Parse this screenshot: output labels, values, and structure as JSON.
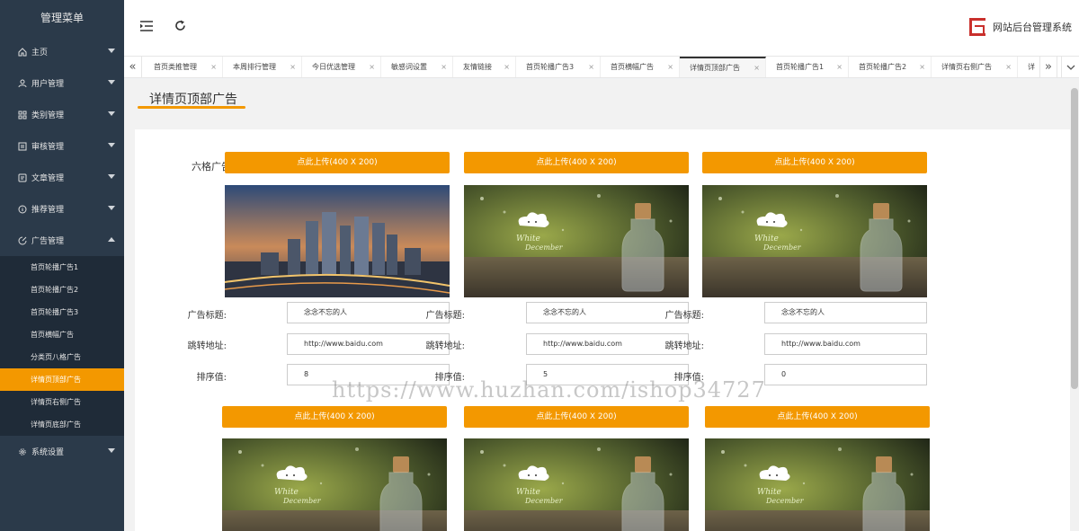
{
  "sidebar": {
    "title": "管理菜单",
    "menus": [
      {
        "label": "主页",
        "icon": "home-icon"
      },
      {
        "label": "用户管理",
        "icon": "user-icon"
      },
      {
        "label": "类别管理",
        "icon": "grid-icon"
      },
      {
        "label": "审核管理",
        "icon": "checklist-icon"
      },
      {
        "label": "文章管理",
        "icon": "article-icon"
      },
      {
        "label": "推荐管理",
        "icon": "info-icon"
      },
      {
        "label": "广告管理",
        "icon": "ad-icon"
      }
    ],
    "submenu": [
      "首页轮播广告1",
      "首页轮播广告2",
      "首页轮播广告3",
      "首页横幅广告",
      "分类页八格广告",
      "详情页顶部广告",
      "详情页右侧广告",
      "详情页底部广告"
    ],
    "active_sub_index": 5,
    "settings": {
      "label": "系统设置",
      "icon": "gear-icon"
    }
  },
  "header": {
    "collapse_icon": "menu-collapse-icon",
    "refresh_icon": "refresh-icon",
    "brand_text": "网站后台管理系统"
  },
  "tabs": {
    "items": [
      "首页类推管理",
      "本周排行管理",
      "今日优选管理",
      "敏感词设置",
      "友情链接",
      "首页轮播广告3",
      "首页横幅广告",
      "详情页顶部广告",
      "首页轮播广告1",
      "首页轮播广告2",
      "详情页右侧广告",
      "详"
    ],
    "active_index": 7,
    "prev_icon": "double-chevron-left-icon",
    "next_icon": "double-chevron-right-icon",
    "menu_icon": "chevron-down-icon"
  },
  "page": {
    "title": "详情页顶部广告",
    "section_label": "六格广告",
    "upload_label": "点此上传(400 X 200)",
    "field_labels": {
      "title": "广告标题:",
      "url": "跳转地址:",
      "sort": "排序值:"
    },
    "ads_row1": [
      {
        "image": "city-skyline",
        "title": "念念不忘的人",
        "url": "http://www.baidu.com",
        "sort": "8"
      },
      {
        "image": "white-december-bottle",
        "title": "念念不忘的人",
        "url": "http://www.baidu.com",
        "sort": "5"
      },
      {
        "image": "white-december-bottle",
        "title": "念念不忘的人",
        "url": "http://www.baidu.com",
        "sort": "0"
      }
    ],
    "ads_row2": [
      {
        "image": "white-december-bottle"
      },
      {
        "image": "white-december-bottle"
      },
      {
        "image": "white-december-bottle"
      }
    ],
    "watermark": "https://www.huzhan.com/ishop34727"
  },
  "colors": {
    "accent": "#f39800",
    "sidebar": "#2b3a4a",
    "brand": "#c9302c"
  }
}
